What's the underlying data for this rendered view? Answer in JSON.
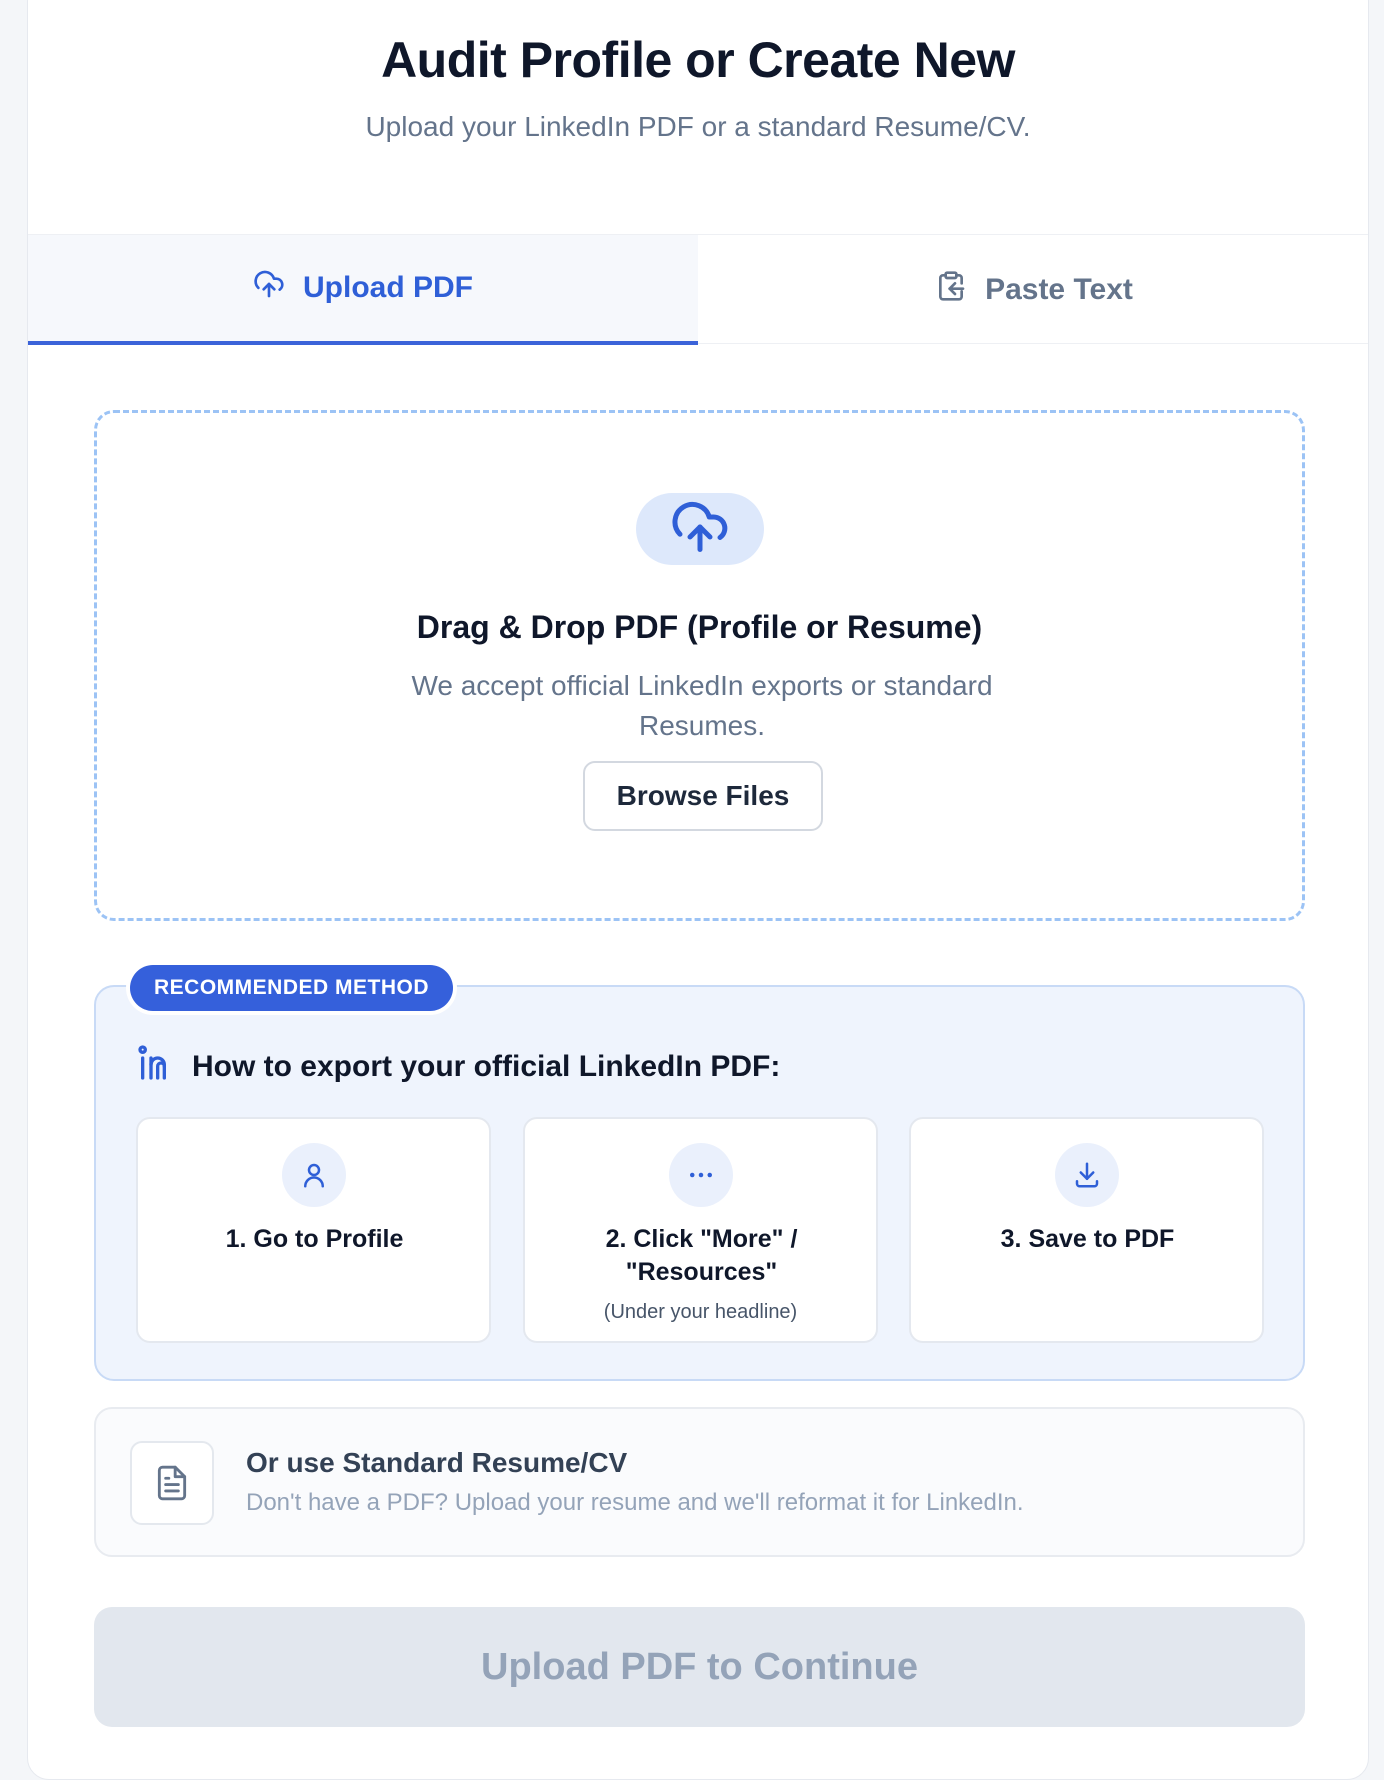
{
  "header": {
    "title": "Audit Profile or Create New",
    "subtitle": "Upload your LinkedIn PDF or a standard Resume/CV."
  },
  "tabs": [
    {
      "label": "Upload PDF",
      "icon": "cloud-upload-icon",
      "active": true
    },
    {
      "label": "Paste Text",
      "icon": "clipboard-icon",
      "active": false
    }
  ],
  "dropzone": {
    "icon": "cloud-upload-icon",
    "title": "Drag & Drop PDF (Profile or Resume)",
    "subtitle": "We accept official LinkedIn exports or standard Resumes.",
    "browse_label": "Browse Files"
  },
  "recommended": {
    "badge": "RECOMMENDED METHOD",
    "heading": "How to export your official LinkedIn PDF:",
    "heading_icon": "linkedin-icon",
    "steps": [
      {
        "label": "1. Go to Profile",
        "icon": "user-icon",
        "note": ""
      },
      {
        "label": "2. Click \"More\" / \"Resources\"",
        "icon": "more-dots-icon",
        "note": "(Under your headline)"
      },
      {
        "label": "3. Save to PDF",
        "icon": "download-icon",
        "note": ""
      }
    ]
  },
  "standard": {
    "icon": "document-icon",
    "title": "Or use Standard Resume/CV",
    "subtitle": "Don't have a PDF? Upload your resume and we'll reformat it for LinkedIn."
  },
  "continue_label": "Upload PDF to Continue",
  "colors": {
    "accent": "#3560db",
    "muted_text": "#64748b",
    "dropzone_border": "#9cc3f5",
    "recommended_bg": "#eff4fd",
    "disabled_bg": "#e2e7ee"
  }
}
